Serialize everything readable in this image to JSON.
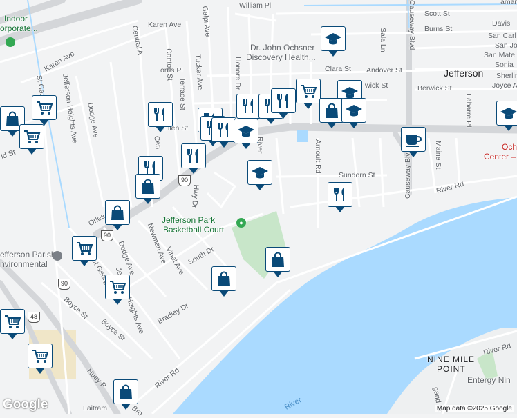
{
  "map": {
    "colors": {
      "water": "#aadaff",
      "park": "#c8e6c9",
      "road": "#ffffff",
      "highway": "#d4d6d9",
      "land": "#f2f3f4",
      "pin_border": "#0a4a78"
    },
    "attribution": "Map data ©2025 Google",
    "logo": "Google",
    "labels": {
      "city_jefferson": "Jefferson",
      "nine_mile": "NINE MILE",
      "point": "POINT",
      "hospital": "Dr. John Ochsner",
      "hospital2": "Discovery Health...",
      "park1": "Jefferson Park",
      "park2": "Basketball Court",
      "indoor1": "Indoor",
      "indoor2": "orporate...",
      "ochsner1": "Och",
      "ochsner2": "Center –",
      "parish1": "efferson Parish",
      "parish2": "nvironmental",
      "entergy": "Entergy Nin",
      "river_water": "River",
      "william": "William Pl",
      "karen": "Karen Ave",
      "karen2": "Karen Ave",
      "central": "Central A",
      "gelpi": "Gelpi Ave",
      "honore": "Honore Dr",
      "canton": "Canton St",
      "tucker": "Tucker Ave",
      "terrace": "Terrace St",
      "orris": "orris Pl",
      "ellen": "Ellen St",
      "cen": "Cen",
      "hwy": "Hwy Dr",
      "river_dr": "River",
      "arnoult": "Arnoult Rd",
      "sundorn": "Sundorn St",
      "river_rd": "River Rd",
      "river_rd2": "River Rd",
      "river_rd3": "River Rd",
      "causeway": "Causeway Blvd",
      "causeway2": "Causeway Blvd",
      "maine": "Maine St",
      "labarre": "Labarre Pl",
      "clara": "Clara St",
      "andover": "Andover St",
      "berwick": "Berwick St",
      "berwick2": "wick St",
      "scott": "Scott St",
      "burns": "Burns St",
      "sala": "Sala Ln",
      "davis": "Davis",
      "sancar": "San Carl",
      "sanjo": "San Jo",
      "sanmat": "San Mate",
      "sonia": "Sonia",
      "sherli": "Sherlin",
      "joyce": "Joyce A",
      "jeff_heights": "Jefferson Heights Ave",
      "jeff_heights2": "Jefferson Heights Ave",
      "dodge": "Dodge Ave",
      "dodge2": "Dodge Ave",
      "newman": "Newman Ave",
      "vinet": "Vinet Ave",
      "southdr": "South Dr",
      "bradley": "Bradley Dr",
      "boyce": "Boyce St",
      "boyce2": "Boyce St",
      "stgeo": "St Geo",
      "stgeorge": "St George",
      "orlea": "Orlea",
      "ld": "ld St",
      "huey": "Huey P",
      "laitram": "Laitram",
      "gand": "gand Dr",
      "bro": "Bro",
      "kaman": "aman"
    },
    "shields": [
      "90",
      "90",
      "90",
      "48"
    ],
    "pins": [
      {
        "type": "education"
      },
      {
        "type": "restaurant"
      },
      {
        "type": "restaurant"
      },
      {
        "type": "restaurant"
      },
      {
        "type": "grocery"
      },
      {
        "type": "education"
      },
      {
        "type": "shopping"
      },
      {
        "type": "education"
      },
      {
        "type": "restaurant"
      },
      {
        "type": "restaurant"
      },
      {
        "type": "restaurant"
      },
      {
        "type": "education"
      },
      {
        "type": "restaurant"
      },
      {
        "type": "restaurant"
      },
      {
        "type": "education"
      },
      {
        "type": "restaurant"
      },
      {
        "type": "cafe"
      },
      {
        "type": "education"
      },
      {
        "type": "shopping"
      },
      {
        "type": "grocery"
      },
      {
        "type": "restaurant"
      },
      {
        "type": "grocery"
      },
      {
        "type": "shopping"
      },
      {
        "type": "shopping"
      },
      {
        "type": "shopping"
      },
      {
        "type": "shopping"
      },
      {
        "type": "grocery"
      },
      {
        "type": "grocery"
      },
      {
        "type": "grocery"
      },
      {
        "type": "grocery"
      },
      {
        "type": "shopping"
      }
    ]
  }
}
